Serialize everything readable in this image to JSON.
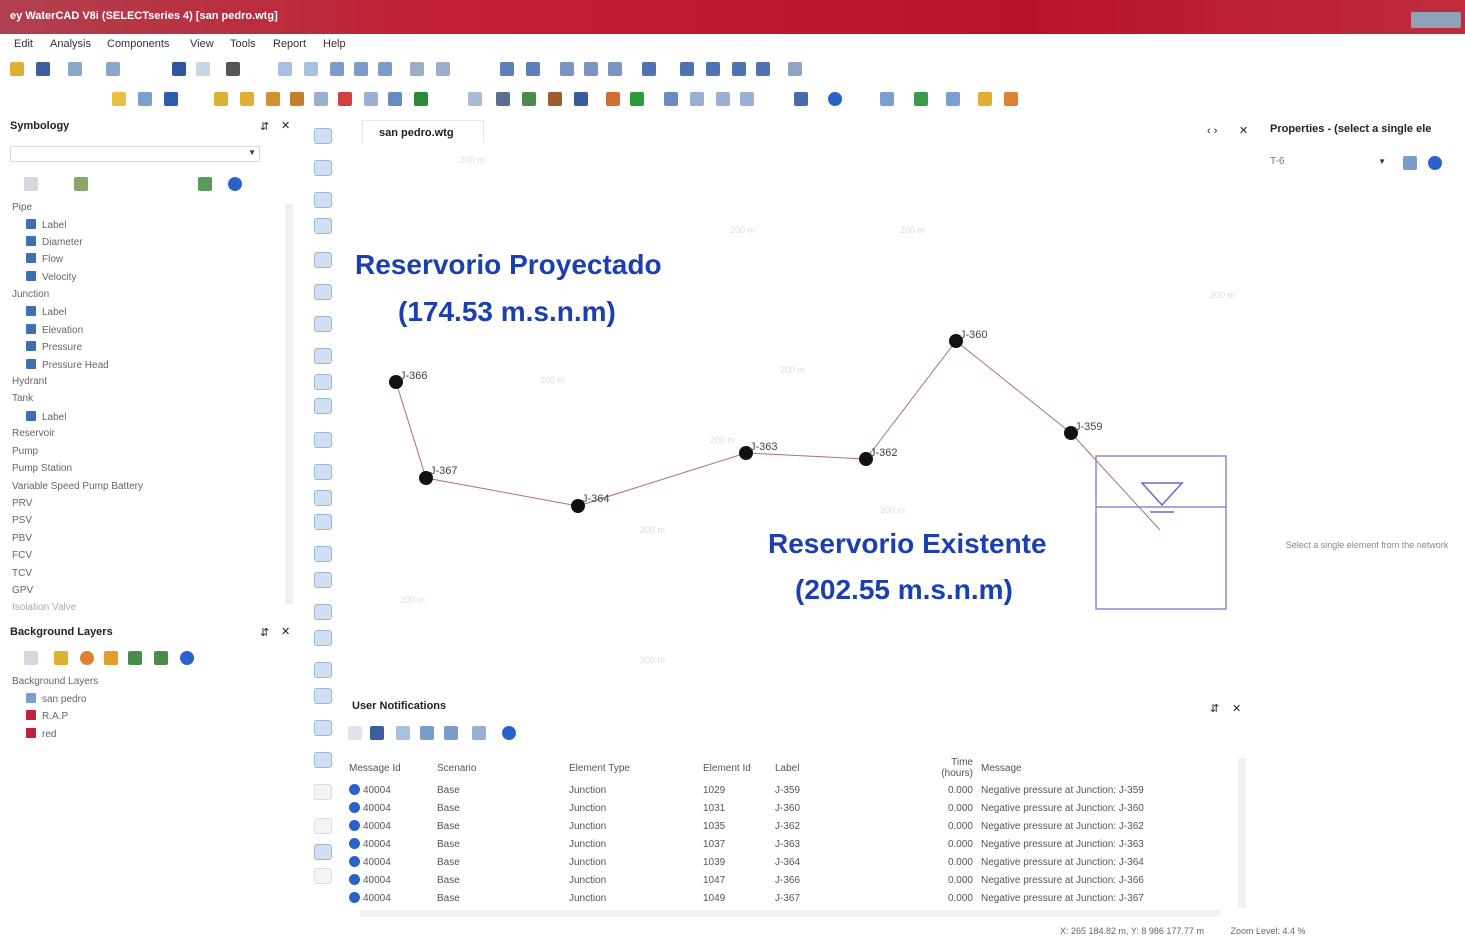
{
  "window": {
    "title": "ey WaterCAD V8i (SELECTseries 4) [san pedro.wtg]"
  },
  "menu": [
    "Edit",
    "Analysis",
    "Components",
    "View",
    "Tools",
    "Report",
    "Help"
  ],
  "symbology": {
    "title": "Symbology",
    "tree": [
      "Pipe",
      "Label",
      "Diameter",
      "Flow",
      "Velocity",
      "Junction",
      "Label",
      "Elevation",
      "Pressure",
      "Pressure Head",
      "Hydrant",
      "Tank",
      "Label",
      "Reservoir",
      "Pump",
      "Pump Station",
      "Variable Speed Pump Battery",
      "PRV",
      "PSV",
      "PBV",
      "FCV",
      "TCV",
      "GPV",
      "Isolation Valve"
    ]
  },
  "background_layers": {
    "title": "Background Layers",
    "tree": [
      "Background Layers",
      "san pedro",
      "R.A.P",
      "red"
    ]
  },
  "document_tab": "san pedro.wtg",
  "properties": {
    "title": "Properties - (select a single ele",
    "dropdown": "T-6",
    "message": "Select a single element from the network"
  },
  "canvas": {
    "reservoir_proyectado": {
      "line1": "Reservorio Proyectado",
      "line2": "(174.53  m.s.n.m)"
    },
    "reservoir_existente": {
      "line1": "Reservorio Existente",
      "line2": "(202.55 m.s.n.m)"
    },
    "nodes": [
      "J-366",
      "J-367",
      "J-364",
      "J-363",
      "J-362",
      "J-360",
      "J-359"
    ]
  },
  "notifications": {
    "title": "User Notifications",
    "columns": [
      "Message Id",
      "Scenario",
      "Element Type",
      "Element Id",
      "Label",
      "Time (hours)",
      "Message"
    ],
    "rows": [
      [
        "40004",
        "Base",
        "Junction",
        "1029",
        "J-359",
        "0.000",
        "Negative pressure at Junction: J-359"
      ],
      [
        "40004",
        "Base",
        "Junction",
        "1031",
        "J-360",
        "0.000",
        "Negative pressure at Junction: J-360"
      ],
      [
        "40004",
        "Base",
        "Junction",
        "1035",
        "J-362",
        "0.000",
        "Negative pressure at Junction: J-362"
      ],
      [
        "40004",
        "Base",
        "Junction",
        "1037",
        "J-363",
        "0.000",
        "Negative pressure at Junction: J-363"
      ],
      [
        "40004",
        "Base",
        "Junction",
        "1039",
        "J-364",
        "0.000",
        "Negative pressure at Junction: J-364"
      ],
      [
        "40004",
        "Base",
        "Junction",
        "1047",
        "J-366",
        "0.000",
        "Negative pressure at Junction: J-366"
      ],
      [
        "40004",
        "Base",
        "Junction",
        "1049",
        "J-367",
        "0.000",
        "Negative pressure at Junction: J-367"
      ]
    ]
  },
  "status": {
    "coords": "X: 265 184.82 m, Y: 8 986 177.77 m",
    "zoom": "Zoom Level: 4.4 %"
  },
  "colors": {
    "title_bar": "#c21f35",
    "annotation_blue": "#1b3fae",
    "tank_outline": "#8a8ad6"
  }
}
